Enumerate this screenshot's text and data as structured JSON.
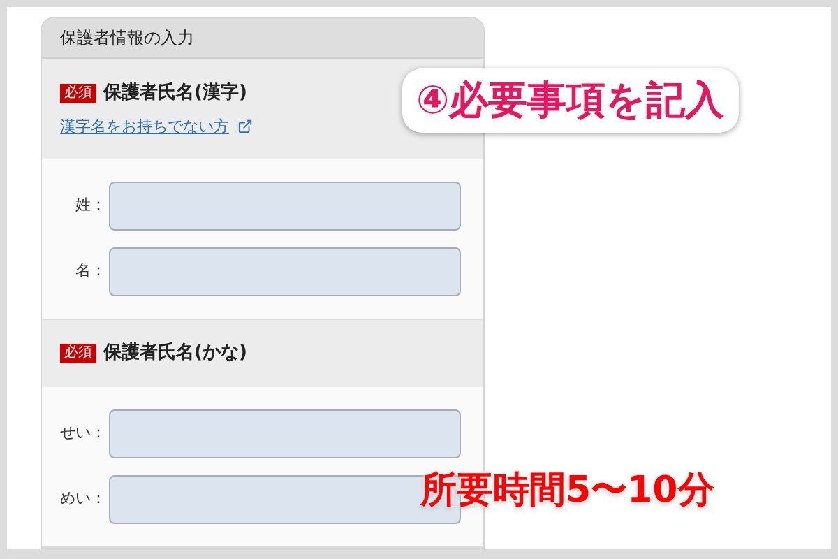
{
  "panel": {
    "title": "保護者情報の入力",
    "sections": [
      {
        "badge": "必須",
        "title": "保護者氏名(漢字)",
        "link": "漢字名をお持ちでない方",
        "fields": [
          {
            "label": "姓："
          },
          {
            "label": "名："
          }
        ]
      },
      {
        "badge": "必須",
        "title": "保護者氏名(かな)",
        "fields": [
          {
            "label": "せい："
          },
          {
            "label": "めい："
          }
        ]
      }
    ]
  },
  "callout": "④必要事項を記入",
  "note": "所要時間5〜10分"
}
